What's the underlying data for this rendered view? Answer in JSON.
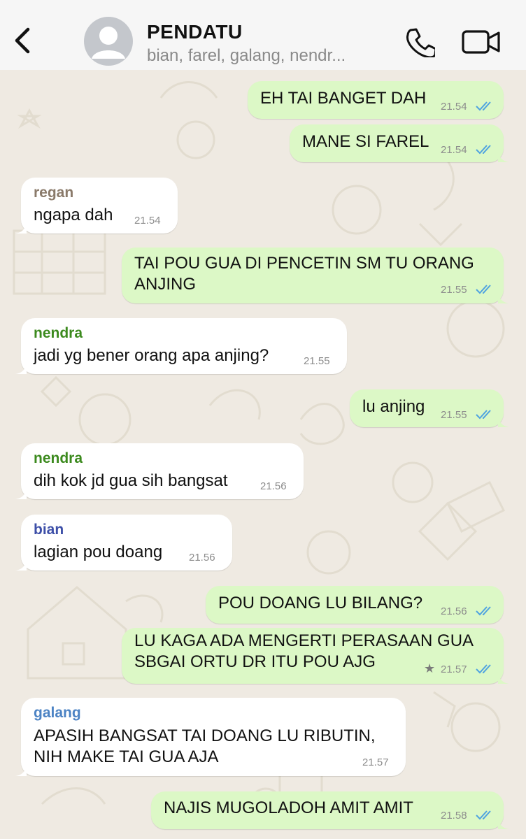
{
  "header": {
    "title": "PENDATU",
    "subtitle": "bian, farel, galang, nendr...",
    "back_icon": "chevron-left-icon",
    "call_icon": "phone-icon",
    "video_icon": "video-camera-icon",
    "avatar_icon": "person-avatar-icon",
    "background": "#f6f6f6"
  },
  "colors": {
    "outgoing_bubble": "#dcf8c6",
    "incoming_bubble": "#ffffff",
    "read_ticks": "#4fa3e0",
    "sender_regan": "#8a7a6a",
    "sender_nendra": "#3c8a1e",
    "sender_bian": "#3d4fa8",
    "sender_galang": "#4c83c4"
  },
  "messages": [
    {
      "id": "m1",
      "dir": "out",
      "lines": [
        "EH TAI BANGET DAH"
      ],
      "time": "21.54",
      "ticks": "read"
    },
    {
      "id": "m2",
      "dir": "out",
      "lines": [
        "MANE SI FAREL"
      ],
      "time": "21.54",
      "ticks": "read"
    },
    {
      "id": "m3",
      "dir": "in",
      "sender": "regan",
      "lines": [
        "ngapa dah"
      ],
      "time": "21.54"
    },
    {
      "id": "m4",
      "dir": "out",
      "lines": [
        "TAI POU GUA DI PENCETIN SM TU ORANG",
        "ANJING"
      ],
      "time": "21.55",
      "ticks": "read"
    },
    {
      "id": "m5",
      "dir": "in",
      "sender": "nendra",
      "lines": [
        "jadi yg bener orang apa anjing?"
      ],
      "time": "21.55"
    },
    {
      "id": "m6",
      "dir": "out",
      "lines": [
        "lu anjing"
      ],
      "time": "21.55",
      "ticks": "read"
    },
    {
      "id": "m7",
      "dir": "in",
      "sender": "nendra",
      "lines": [
        "dih kok jd gua sih bangsat"
      ],
      "time": "21.56"
    },
    {
      "id": "m8",
      "dir": "in",
      "sender": "bian",
      "lines": [
        "lagian pou doang"
      ],
      "time": "21.56"
    },
    {
      "id": "m9",
      "dir": "out",
      "lines": [
        "POU DOANG LU BILANG?"
      ],
      "time": "21.56",
      "ticks": "read"
    },
    {
      "id": "m10",
      "dir": "out",
      "lines": [
        "LU KAGA ADA MENGERTI PERASAAN GUA",
        "SBGAI ORTU DR ITU POU AJG"
      ],
      "time": "21.57",
      "ticks": "read",
      "starred": true,
      "star_symbol": "★"
    },
    {
      "id": "m11",
      "dir": "in",
      "sender": "galang",
      "lines": [
        "APASIH BANGSAT TAI DOANG LU RIBUTIN,",
        "NIH MAKE TAI GUA AJA"
      ],
      "time": "21.57"
    },
    {
      "id": "m12",
      "dir": "out",
      "lines": [
        "NAJIS MUGOLADOH AMIT AMIT"
      ],
      "time": "21.58",
      "ticks": "read"
    }
  ]
}
